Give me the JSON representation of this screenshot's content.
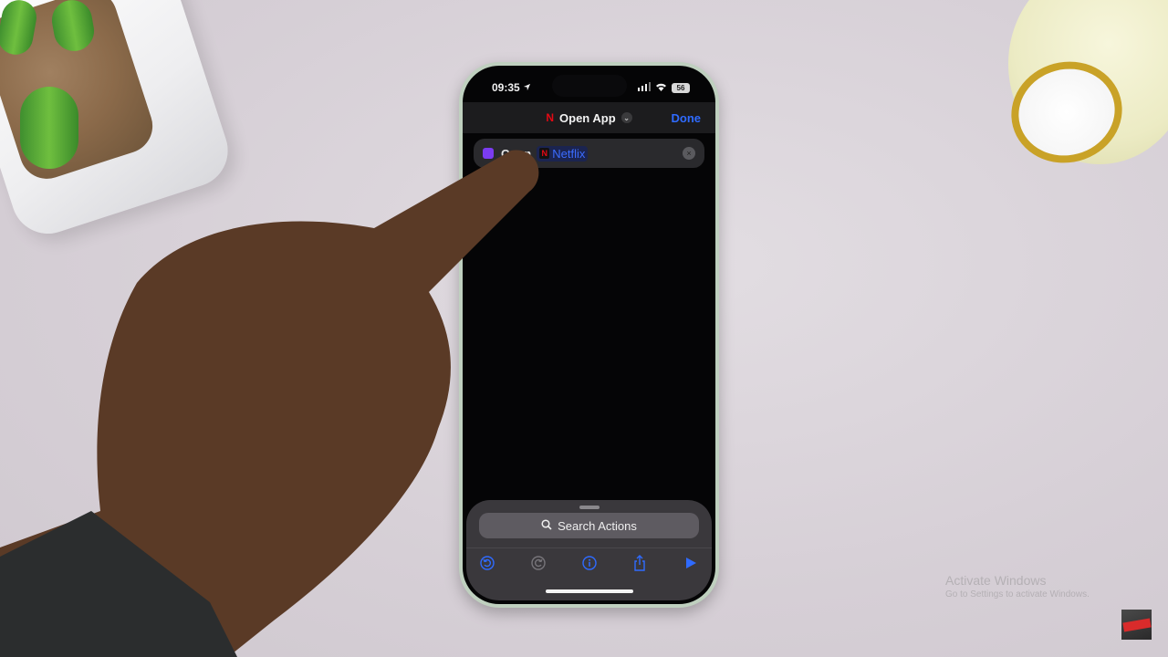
{
  "status_bar": {
    "time": "09:35",
    "location_icon": "location-arrow-icon",
    "signal_icon": "cellular-signal-icon",
    "wifi_icon": "wifi-icon",
    "battery_level": "56"
  },
  "nav": {
    "app_icon": "N",
    "title": "Open App",
    "chevron": "⌄",
    "done_label": "Done"
  },
  "action": {
    "verb": "Open",
    "app_name": "Netflix",
    "app_icon": "N",
    "remove_glyph": "×"
  },
  "bottom_sheet": {
    "search_placeholder": "Search Actions",
    "toolbar": [
      "undo",
      "redo",
      "info",
      "share",
      "run"
    ]
  },
  "watermark": {
    "line1": "Activate Windows",
    "line2": "Go to Settings to activate Windows."
  },
  "colors": {
    "accent_blue": "#2f6bff",
    "netflix_red": "#e50914",
    "shortcut_purple": "#7b3cf0"
  }
}
